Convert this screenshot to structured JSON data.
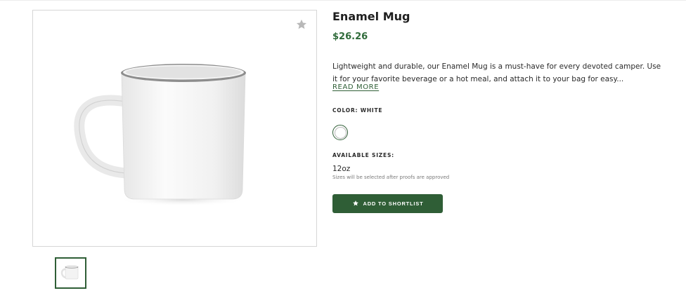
{
  "product": {
    "title": "Enamel Mug",
    "price": "$26.26",
    "description": "Lightweight and durable, our Enamel Mug is a must-have for every devoted camper. Use it for your favorite beverage or a hot meal, and attach it to your bag for easy...",
    "read_more_label": "READ MORE"
  },
  "options": {
    "color_label": "COLOR: WHITE",
    "selected_color": "#ffffff",
    "sizes_label": "AVAILABLE SIZES:",
    "size_value": "12oz",
    "size_note": "Sizes will be selected after proofs are approved"
  },
  "actions": {
    "shortlist_label": "ADD TO SHORTLIST"
  },
  "icons": {
    "favorite": "star-icon",
    "shortlist": "star-icon"
  },
  "colors": {
    "accent": "#2f5e36",
    "price": "#2f6b3a"
  }
}
